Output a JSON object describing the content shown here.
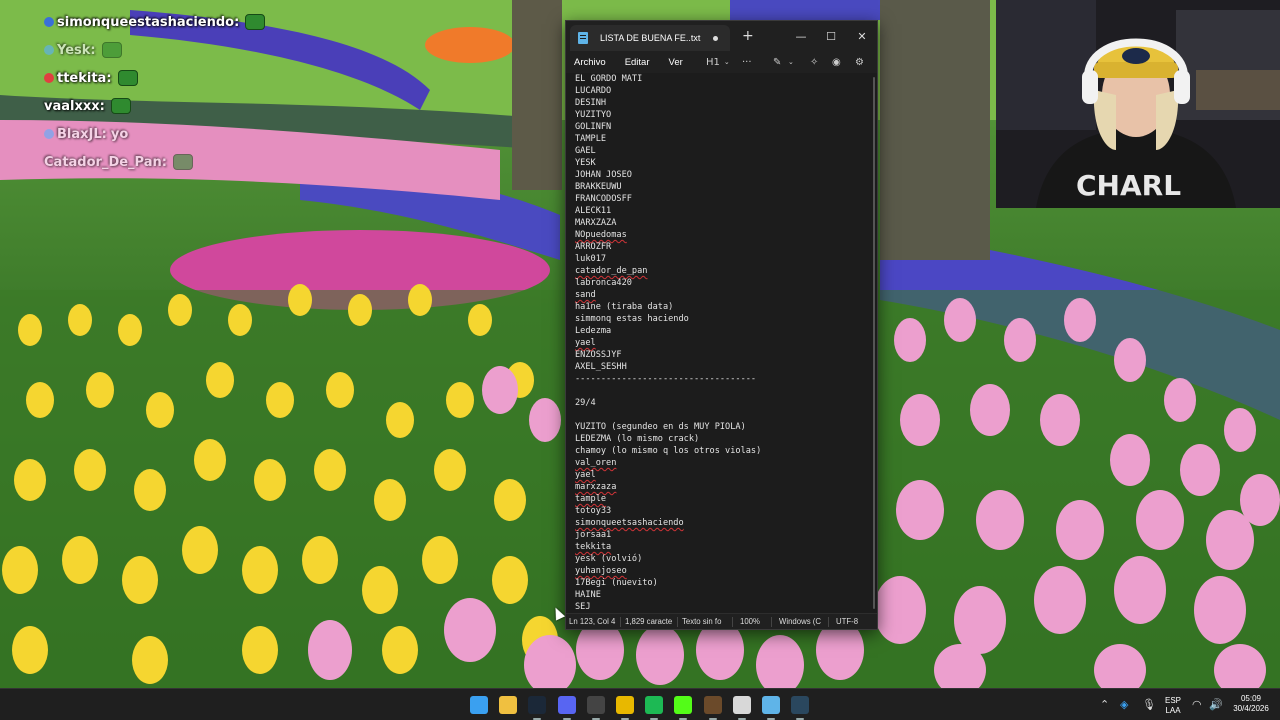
{
  "chat": {
    "messages": [
      {
        "user": "simonqueestashaciendo:",
        "text": "",
        "faded": false,
        "badge_color": "#3a6fd8"
      },
      {
        "user": "Yesk:",
        "text": "",
        "faded": true,
        "badge_color": "#5ab0ff"
      },
      {
        "user": "ttekita:",
        "text": "",
        "faded": false,
        "badge_color": "#e04040"
      },
      {
        "user": "vaalxxx:",
        "text": "",
        "faded": false,
        "badge_color": ""
      },
      {
        "user": "BlaxJL:",
        "text": "yo",
        "faded": true,
        "badge_color": "#5ab0ff"
      },
      {
        "user": "Catador_De_Pan:",
        "text": "",
        "faded": true,
        "badge_color": ""
      }
    ]
  },
  "notepad": {
    "tab_title": "LISTA DE BUENA FE..txt",
    "new_tab": "+",
    "controls": {
      "minimize": "—",
      "maximize": "☐",
      "close": "✕"
    },
    "menu": [
      "Archivo",
      "Editar",
      "Ver"
    ],
    "heading_button": "H1",
    "more_button": "···",
    "lines": [
      {
        "text": "EL GORDO MATI",
        "spell": false
      },
      {
        "text": "LUCARDO",
        "spell": false
      },
      {
        "text": "DESINH",
        "spell": false
      },
      {
        "text": "YUZITYO",
        "spell": false
      },
      {
        "text": "GOLINFN",
        "spell": false
      },
      {
        "text": "TAMPLE",
        "spell": false
      },
      {
        "text": "GAEL",
        "spell": false
      },
      {
        "text": "YESK",
        "spell": false
      },
      {
        "text": "JOHAN JOSEO",
        "spell": false
      },
      {
        "text": "BRAKKEUWU",
        "spell": false
      },
      {
        "text": "FRANCODOSFF",
        "spell": false
      },
      {
        "text": "ALECK11",
        "spell": false
      },
      {
        "text": "MARXZAZA",
        "spell": false
      },
      {
        "text": "NOpuedomas",
        "spell": true
      },
      {
        "text": "ARROZFR",
        "spell": false
      },
      {
        "text": "luk017",
        "spell": false
      },
      {
        "text": "catador_de_pan",
        "spell": true
      },
      {
        "text": "labronca420",
        "spell": false
      },
      {
        "text": "sand",
        "spell": true
      },
      {
        "text": "ha1ne (tiraba data)",
        "spell": false
      },
      {
        "text": "simmonq estas haciendo",
        "spell": false
      },
      {
        "text": "Ledezma",
        "spell": false
      },
      {
        "text": "yael",
        "spell": true
      },
      {
        "text": "ENZOSSJYF",
        "spell": false
      },
      {
        "text": "AXEL_SESHH",
        "spell": false
      },
      {
        "text": "-----------------------------------",
        "spell": false
      },
      {
        "text": "",
        "spell": false
      },
      {
        "text": "29/4",
        "spell": false
      },
      {
        "text": "",
        "spell": false
      },
      {
        "text": "YUZITO (segundeo en ds MUY PIOLA)",
        "spell": false
      },
      {
        "text": "LEDEZMA (lo mismo crack)",
        "spell": false
      },
      {
        "text": "chamoy (lo mismo q los otros violas)",
        "spell": false
      },
      {
        "text": "val_oren",
        "spell": true
      },
      {
        "text": "yael",
        "spell": true
      },
      {
        "text": "marxzaza",
        "spell": true
      },
      {
        "text": "tample",
        "spell": true
      },
      {
        "text": "totoy33",
        "spell": false
      },
      {
        "text": "simonqueetsashaciendo",
        "spell": true
      },
      {
        "text": "jorsaa1",
        "spell": false
      },
      {
        "text": "tekkita",
        "spell": true
      },
      {
        "text": "yesk (volvió)",
        "spell": false
      },
      {
        "text": "yuhanjoseo",
        "spell": true
      },
      {
        "text": "17Begi (nuevito)",
        "spell": false
      },
      {
        "text": "HAINE",
        "spell": false
      },
      {
        "text": "SEJ",
        "spell": false
      }
    ],
    "status": {
      "position": "Ln 123, Col 4",
      "chars": "1,829 caracte",
      "format": "Texto sin fo",
      "zoom": "100%",
      "line_ending": "Windows (C",
      "encoding": "UTF-8"
    }
  },
  "taskbar": {
    "apps": [
      {
        "name": "start-button",
        "glyph": "",
        "color": "#3aa0f0"
      },
      {
        "name": "file-explorer-icon",
        "glyph": "",
        "color": "#f0c040"
      },
      {
        "name": "steam-icon",
        "glyph": "",
        "color": "#1b2838"
      },
      {
        "name": "discord-icon",
        "glyph": "",
        "color": "#5865f2"
      },
      {
        "name": "obs-icon",
        "glyph": "",
        "color": "#444444"
      },
      {
        "name": "chrome-icon",
        "glyph": "",
        "color": "#e8b800"
      },
      {
        "name": "spotify-icon",
        "glyph": "",
        "color": "#1db954"
      },
      {
        "name": "kick-icon",
        "glyph": "",
        "color": "#53fc18"
      },
      {
        "name": "minecraft-icon",
        "glyph": "",
        "color": "#6b4a2a"
      },
      {
        "name": "ccleaner-icon",
        "glyph": "",
        "color": "#d8d8d8"
      },
      {
        "name": "notepad-icon",
        "glyph": "",
        "color": "#5fb4e8"
      },
      {
        "name": "steam-icon-2",
        "glyph": "",
        "color": "#2a475e"
      }
    ],
    "language_top": "ESP",
    "language_bottom": "LAA",
    "time": "05:09",
    "date": "30/4/2026"
  }
}
